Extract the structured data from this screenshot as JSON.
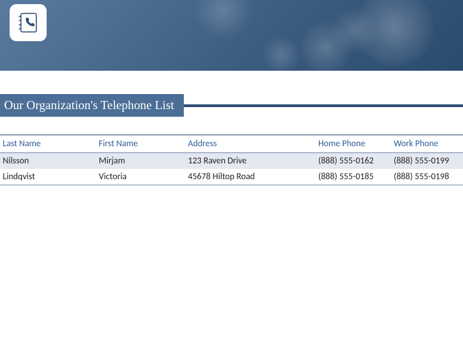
{
  "title": "Our Organization's Telephone List",
  "columns": {
    "last": "Last Name",
    "first": "First Name",
    "address": "Address",
    "home": "Home Phone",
    "work": "Work Phone"
  },
  "rows": [
    {
      "last": "Nilsson",
      "first": "Mirjam",
      "address": "123 Raven Drive",
      "home": "(888) 555-0162",
      "work": "(888) 555-0199"
    },
    {
      "last": "Lindqvist",
      "first": "Victoria",
      "address": "45678 Hiltop Road",
      "home": "(888) 555-0185",
      "work": "(888) 555-0198"
    }
  ]
}
